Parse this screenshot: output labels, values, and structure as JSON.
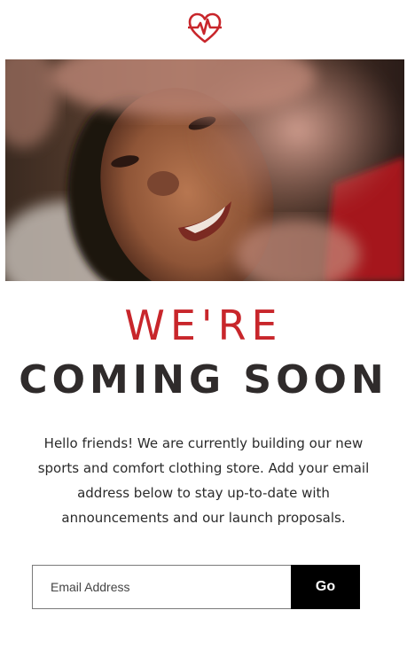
{
  "brand": {
    "logo_icon": "heart-pulse-icon",
    "accent_color": "#c8262b"
  },
  "hero": {
    "image_description_icon": "smiling-woman-photo"
  },
  "heading": {
    "line1": "WE'RE",
    "line2": "COMING SOON",
    "line1_color": "#c8262b",
    "line2_color": "#2f2b2b"
  },
  "description": "Hello friends! We are currently building our new sports and comfort clothing store. Add your email address below to stay up-to-date with announcements and our launch proposals.",
  "signup": {
    "email_placeholder": "Email Address",
    "submit_label": "Go",
    "submit_bg": "#000000",
    "submit_fg": "#ffffff"
  }
}
